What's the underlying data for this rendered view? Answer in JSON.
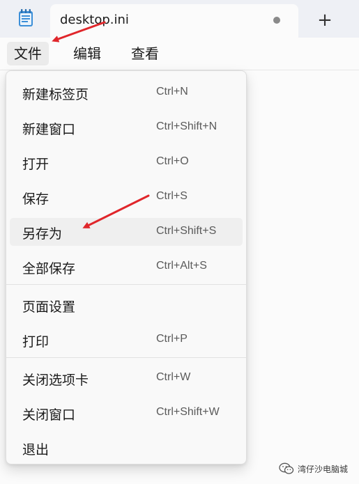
{
  "tab": {
    "title": "desktop.ini",
    "new_tab_symbol": "+"
  },
  "menubar": {
    "file": "文件",
    "edit": "编辑",
    "view": "查看"
  },
  "file_menu": {
    "items": [
      {
        "label": "新建标签页",
        "shortcut": "Ctrl+N"
      },
      {
        "label": "新建窗口",
        "shortcut": "Ctrl+Shift+N"
      },
      {
        "label": "打开",
        "shortcut": "Ctrl+O"
      },
      {
        "label": "保存",
        "shortcut": "Ctrl+S"
      },
      {
        "label": "另存为",
        "shortcut": "Ctrl+Shift+S"
      },
      {
        "label": "全部保存",
        "shortcut": "Ctrl+Alt+S"
      },
      {
        "label": "页面设置",
        "shortcut": ""
      },
      {
        "label": "打印",
        "shortcut": "Ctrl+P"
      },
      {
        "label": "关闭选项卡",
        "shortcut": "Ctrl+W"
      },
      {
        "label": "关闭窗口",
        "shortcut": "Ctrl+Shift+W"
      },
      {
        "label": "退出",
        "shortcut": ""
      }
    ]
  },
  "colors": {
    "annotation_arrow": "#e0262b",
    "hover_background": "#efefef"
  },
  "icons": {
    "app": "notepad-icon",
    "tab_unsaved": "unsaved-dot-icon",
    "watermark": "wechat-icon"
  },
  "watermark": {
    "text": "湾仔沙电脑城"
  }
}
